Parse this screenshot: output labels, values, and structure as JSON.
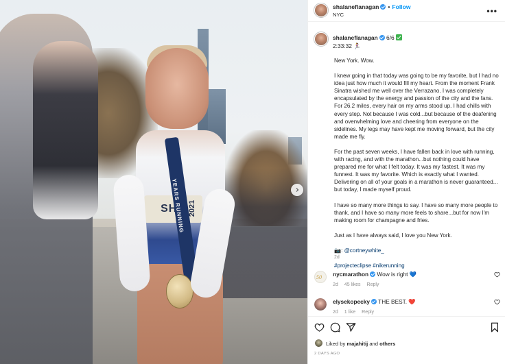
{
  "photo": {
    "bib_text": "SHA",
    "bib_year": "2021",
    "lanyard_text": "YEARS RUNNING",
    "next_icon": "chevron-right-icon"
  },
  "header": {
    "username": "shalaneflanagan",
    "separator": "•",
    "follow_label": "Follow",
    "location": "NYC",
    "more_icon": "•••"
  },
  "caption": {
    "username": "shalaneflanagan",
    "counter": "6/6",
    "time": "2:33:32 🏃‍♀️",
    "paragraphs": [
      "New York. Wow.",
      "I knew going in that today was going to be my favorite, but I had no idea just how much it would fill my heart. From the moment Frank Sinatra wished me well over the Verrazano. I was completely encapsulated by the energy and passion of the city and the fans. For 26.2 miles, every hair on my arms stood up. I had chills with every step. Not because I was cold...but because of the deafening and overwhelming love and cheering from everyone on the sidelines. My legs may have kept me moving forward, but the city made me fly.",
      "For the past seven weeks, I have fallen back in love with running, with racing, and with the marathon...but nothing could have prepared me for what I felt today. It was my fastest. It was my funnest. It was my favorite. Which is exactly what I wanted. Delivering on all of your goals in a marathon is never guaranteed... but today, I made myself proud.",
      "I have so many more things to say. I have so many more people to thank, and I have so many more feels to share...but for now I'm making room for champagne and fries.",
      "Just as I have always said, I love you New York."
    ],
    "photo_credit_prefix": "📷: ",
    "photo_credit_handle": "@cortneywhite_",
    "hashtags": "#projecteclipse #nikerunning",
    "age": "2d"
  },
  "comments": [
    {
      "username": "nycmarathon",
      "text": " Wow is right 💙",
      "age": "2d",
      "likes": "45 likes",
      "reply": "Reply"
    },
    {
      "username": "elysekopecky",
      "text": " THE BEST. ❤️",
      "age": "2d",
      "likes": "1 like",
      "reply": "Reply"
    }
  ],
  "actions": {
    "liked_prefix": "Liked by ",
    "liked_user": "majahitij",
    "liked_and": " and ",
    "liked_others": "others",
    "date": "2 DAYS AGO"
  },
  "colors": {
    "link": "#00376b",
    "follow": "#0095f6",
    "verified": "#3897f0",
    "meta": "#8e8e8e"
  }
}
